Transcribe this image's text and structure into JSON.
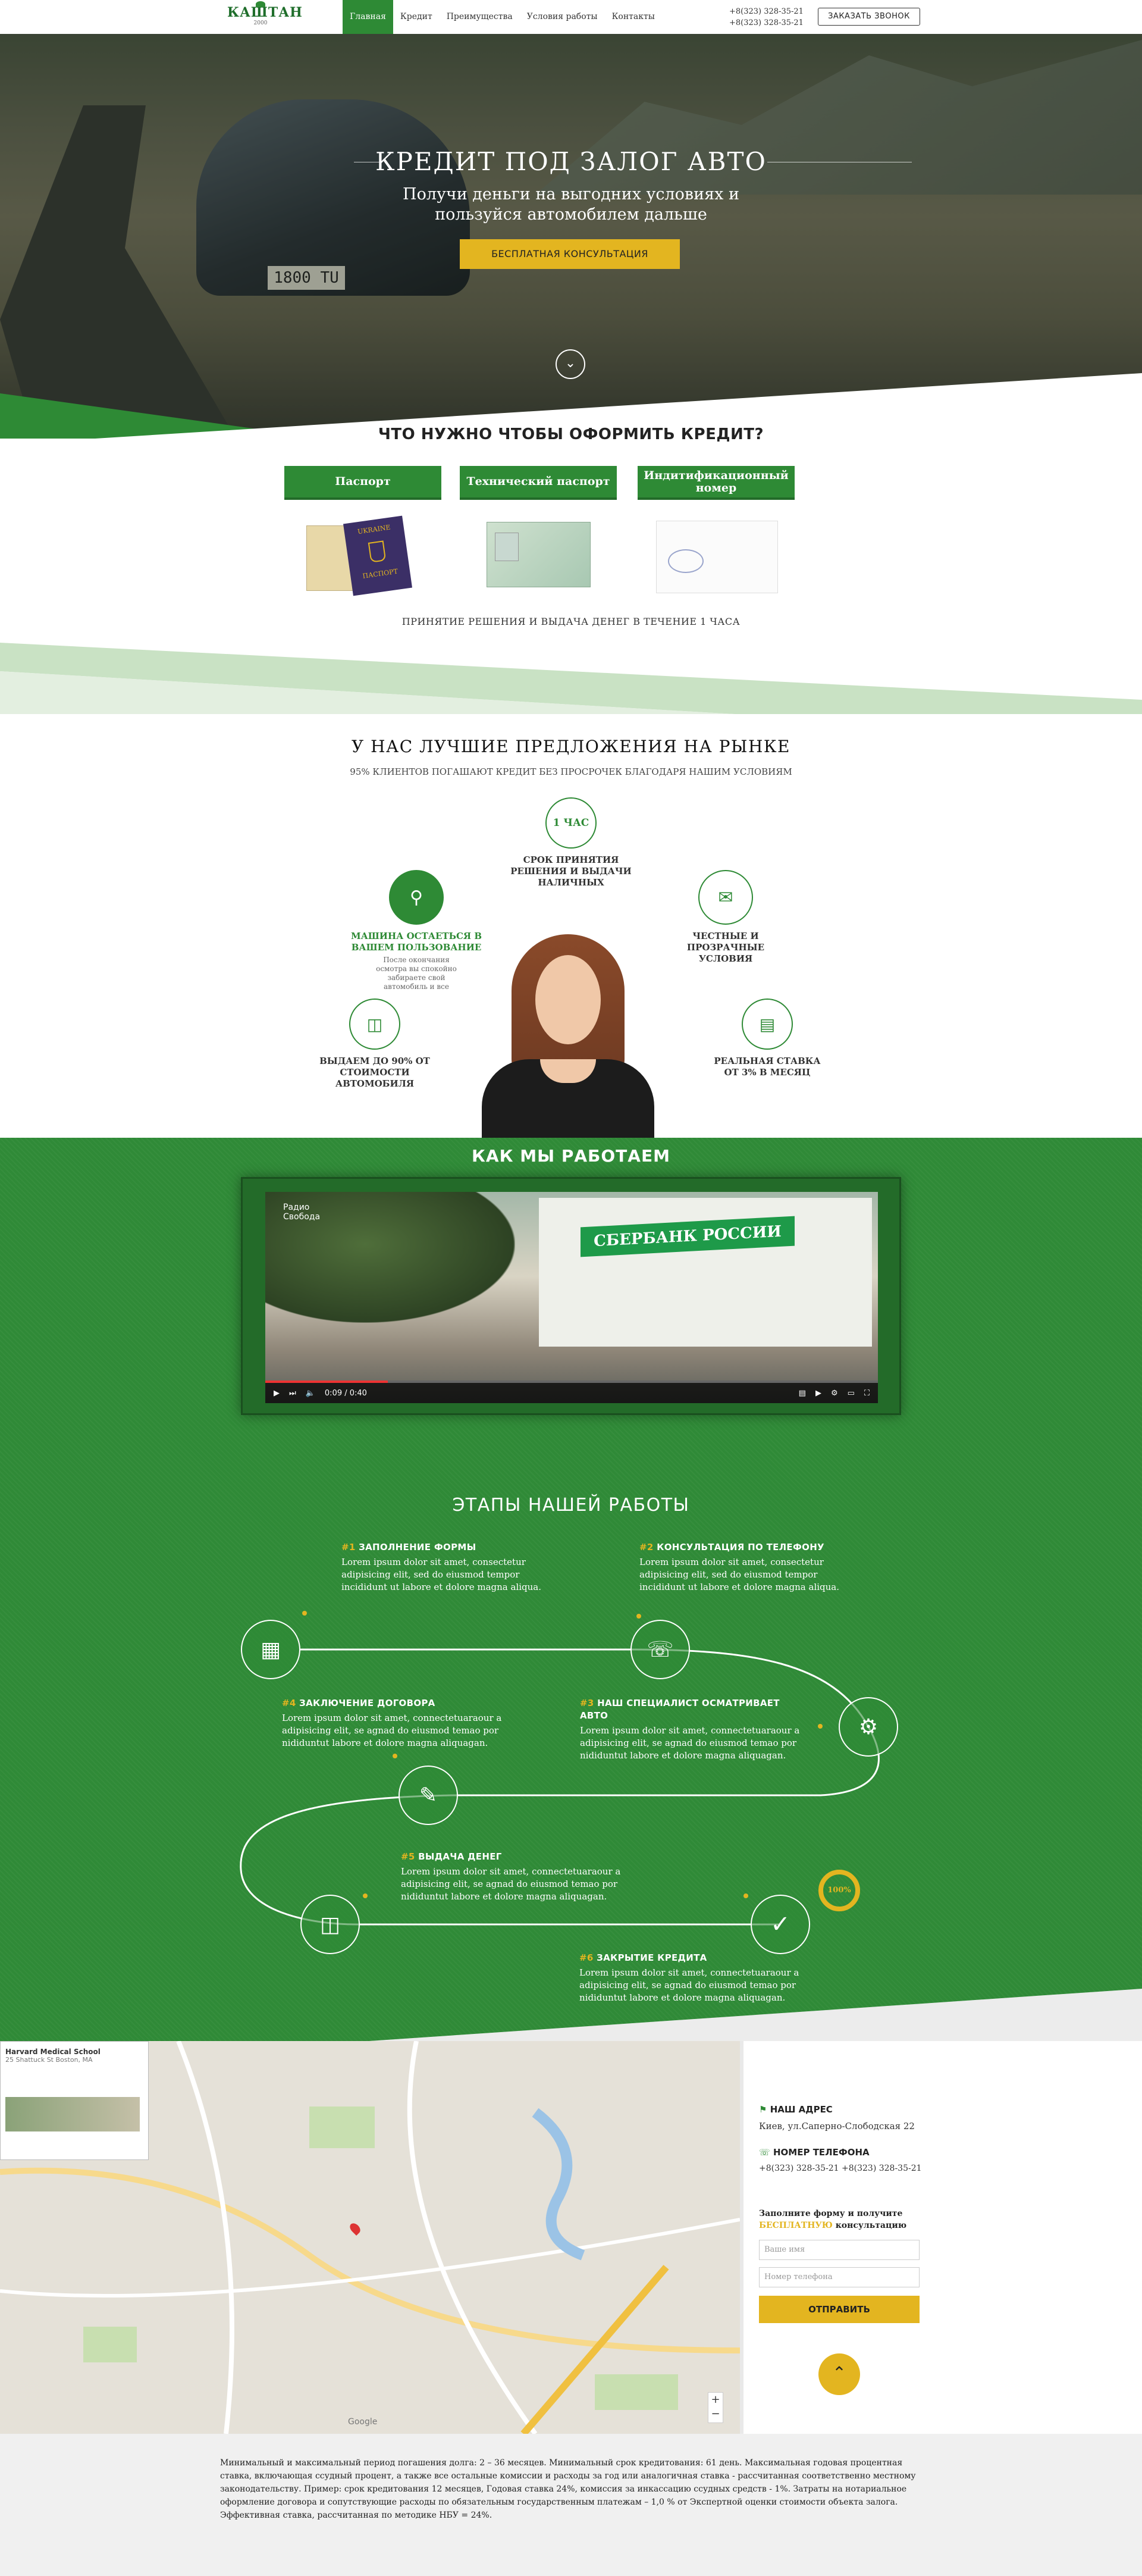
{
  "header": {
    "logo": "КАШТАН",
    "logo_sub": "2000",
    "nav": [
      "Главная",
      "Кредит",
      "Преимущества",
      "Условия работы",
      "Контакты"
    ],
    "phones": [
      "+8(323) 328-35-21",
      "+8(323) 328-35-21"
    ],
    "call_button": "ЗАКАЗАТЬ ЗВОНОК"
  },
  "hero": {
    "plate": "1800 TU",
    "title": "КРЕДИТ ПОД ЗАЛОГ АВТО",
    "subtitle_line1": "Получи деньги на выгодних условиях и",
    "subtitle_line2": "пользуйся автомобилем дальше",
    "cta": "БЕСПЛАТНАЯ КОНСУЛЬТАЦИЯ",
    "down_icon": "chevron-down-icon"
  },
  "requirements": {
    "title": "ЧТО НУЖНО ЧТОБЫ ОФОРМИТЬ КРЕДИТ?",
    "items": [
      "Паспорт",
      "Технический паспорт",
      "Индитификационный номер"
    ],
    "passport_text": "UKRAINE",
    "passport_sub": "ПАСПОРТ",
    "note": "ПРИНЯТИЕ РЕШЕНИЯ И ВЫДАЧА ДЕНЕГ В ТЕЧЕНИЕ 1 ЧАСА"
  },
  "advantages": {
    "title": "У НАС ЛУЧШИЕ ПРЕДЛОЖЕНИЯ НА РЫНКЕ",
    "subtitle": "95% КЛИЕНТОВ ПОГАШАЮТ КРЕДИТ БЕЗ ПРОСРОЧЕК БЛАГОДАРЯ НАШИМ УСЛОВИЯМ",
    "hour_badge": "1 ЧАС",
    "hour_text": "СРОК ПРИНЯТИЯ РЕШЕНИЯ И ВЫДАЧИ НАЛИЧНЫХ",
    "car_text": "МАШИНА ОСТАЕТЬСЯ В ВАШЕМ ПОЛЬЗОВАНИЕ",
    "car_desc": "После окончания осмотра вы спокойно забираете свой автомобиль и все",
    "honest_text": "ЧЕСТНЫЕ И ПРОЗРАЧНЫЕ УСЛОВИЯ",
    "amount_text": "ВЫДАЕМ ДО 90% ОТ СТОИМОСТИ АВТОМОБИЛЯ",
    "rate_text": "РЕАЛЬНАЯ СТАВКА ОТ 3% В МЕСЯЦ",
    "accent": "#2e8a35"
  },
  "work": {
    "title": "КАК МЫ РАБОТАЕМ",
    "video": {
      "channel_line1": "Радио",
      "channel_line2": "Свобода",
      "sign": "СБЕРБАНК РОССИИ",
      "time": "0:09 / 0:40",
      "progress": 0.2
    },
    "stages_title": "ЭТАПЫ НАШЕЙ РАБОТЫ",
    "stages": [
      {
        "num": "#1",
        "title": "ЗАПОЛНЕНИЕ ФОРМЫ",
        "text": "Lorem ipsum dolor sit amet, consectetur adipisicing elit, sed do eiusmod tempor incididunt ut labore et dolore magna aliqua."
      },
      {
        "num": "#2",
        "title": "КОНСУЛЬТАЦИЯ ПО ТЕЛЕФОНУ",
        "text": "Lorem ipsum dolor sit amet, consectetur adipisicing elit, sed do eiusmod tempor incididunt ut labore et dolore magna aliqua."
      },
      {
        "num": "#3",
        "title": "НАШ СПЕЦИАЛИСТ ОСМАТРИВАЕТ АВТО",
        "text": "Lorem ipsum dolor sit amet, connectetuaraour a adipisicing elit, se agnad do eiusmod temao por nididuntut labore et dolore magna aliquagan."
      },
      {
        "num": "#4",
        "title": "ЗАКЛЮЧЕНИЕ ДОГОВОРА",
        "text": "Lorem ipsum dolor sit amet, connectetuaraour a adipisicing elit, se agnad do eiusmod temao por nididuntut labore et dolore magna aliquagan."
      },
      {
        "num": "#5",
        "title": "ВЫДАЧА ДЕНЕГ",
        "text": "Lorem ipsum dolor sit amet, connectetuaraour a adipisicing elit, se agnad do eiusmod temao por nididuntut labore et dolore magna aliquagan."
      },
      {
        "num": "#6",
        "title": "ЗАКРЫТИЕ КРЕДИТА",
        "text": "Lorem ipsum dolor sit amet, connectetuaraour a adipisicing elit, se agnad do eiusmod temao por nididuntut labore et dolore magna aliquagan."
      }
    ],
    "badge": "100%"
  },
  "contacts": {
    "map_card_title": "Harvard Medical School",
    "map_card_addr": "25 Shattuck St Boston, MA",
    "address_title": "НАШ АДРЕС",
    "address": "Киев, ул.Саперно-Слободская 22",
    "phone_title": "НОМЕР ТЕЛЕФОНА",
    "phones": "+8(323) 328-35-21   +8(323) 328-35-21",
    "form_title_1": "Заполните форму и получите",
    "form_title_hl": "БЕСПЛАТНУЮ",
    "form_title_2": "консультацию",
    "name_placeholder": "Ваше имя",
    "phone_placeholder": "Номер телефона",
    "submit": "ОТПРАВИТЬ",
    "up_icon": "chevron-up-icon",
    "google": "Google"
  },
  "footer": {
    "text": "Минимальный и максимальный период погашения долга: 2 – 36 месяцев. Минимальный срок кредитования: 61 день. Максимальная годовая процентная ставка, включающая ссудный процент, а также все остальные комиссии и расходы за год или аналогичная ставка - рассчитанная соответственно местному законодательству. Пример: срок кредитования 12 месяцев, Годовая ставка 24%, комиссия за инкассацию ссудных средств - 1%. Затраты на нотариальное оформление договора и сопутствующие расходы по обязательным государственным платежам – 1,0 % от Экспертной оценки стоимости объекта залога. Эффективная ставка, рассчитанная по методике НБУ = 24%."
  }
}
